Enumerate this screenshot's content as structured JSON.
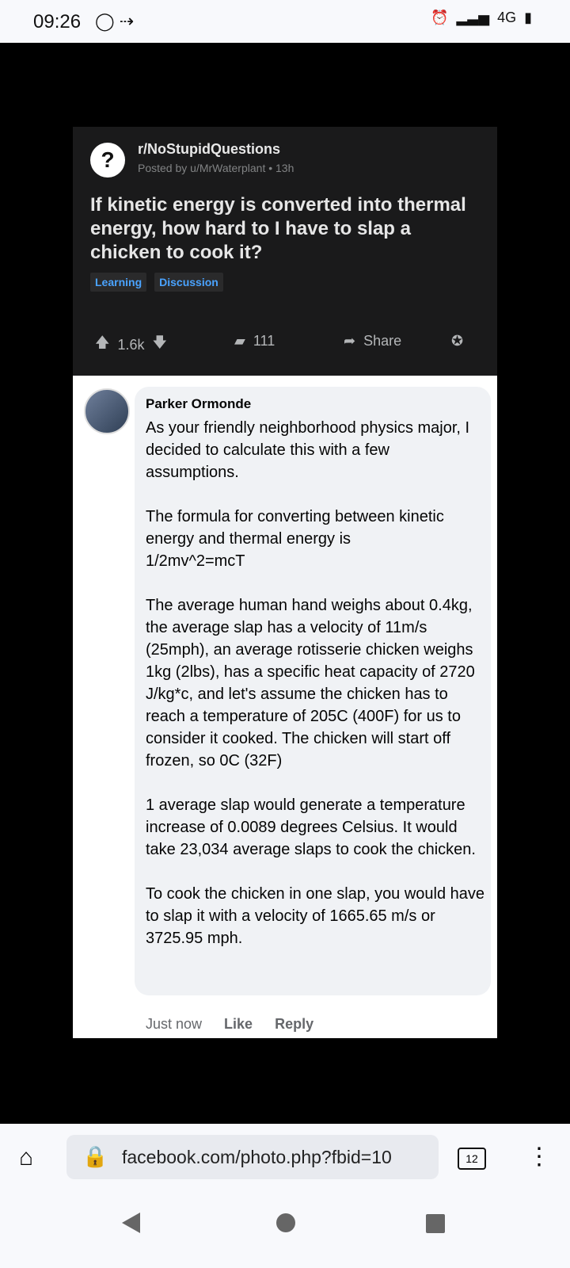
{
  "status_bar": {
    "time": "09:26",
    "right_icons": [
      "alarm-icon",
      "signal-icon",
      "4g-icon",
      "battery-icon"
    ],
    "network": "4G"
  },
  "post": {
    "subreddit": "r/NoStupidQuestions",
    "posted_by": "Posted by u/MrWaterplant • 13h",
    "title": "If kinetic energy is converted into thermal energy, how hard to I have to slap a chicken to cook it?",
    "tags": [
      "Learning",
      "Discussion"
    ],
    "votes": "1.6k",
    "comments": "111",
    "share": "Share"
  },
  "comment": {
    "author": "Parker Ormonde",
    "paragraphs": [
      "As your friendly neighborhood physics major, I decided to calculate this with a few assumptions.",
      "The formula for converting between kinetic energy and thermal energy is\n1/2mv^2=mcT",
      "The average human hand weighs about 0.4kg, the average slap has a velocity of 11m/s (25mph), an average rotisserie chicken weighs 1kg (2lbs), has a specific heat capacity of 2720 J/kg*c, and let's assume the chicken has to reach a temperature of 205C (400F) for us to consider it cooked. The chicken will start off frozen, so 0C (32F)",
      "1 average slap would generate a temperature increase of 0.0089 degrees Celsius. It would take 23,034 average slaps to cook the chicken.",
      "To cook the chicken in one slap, you would have to slap it with a velocity of 1665.65 m/s or 3725.95 mph."
    ],
    "time": "Just now",
    "like": "Like",
    "reply": "Reply"
  },
  "browser": {
    "url": "facebook.com/photo.php?fbid=10",
    "tab_count": "12"
  },
  "colors": {
    "post_bg": "#1a1a1b",
    "tag_text": "#4aa3ff",
    "bubble_bg": "#f0f2f5"
  }
}
